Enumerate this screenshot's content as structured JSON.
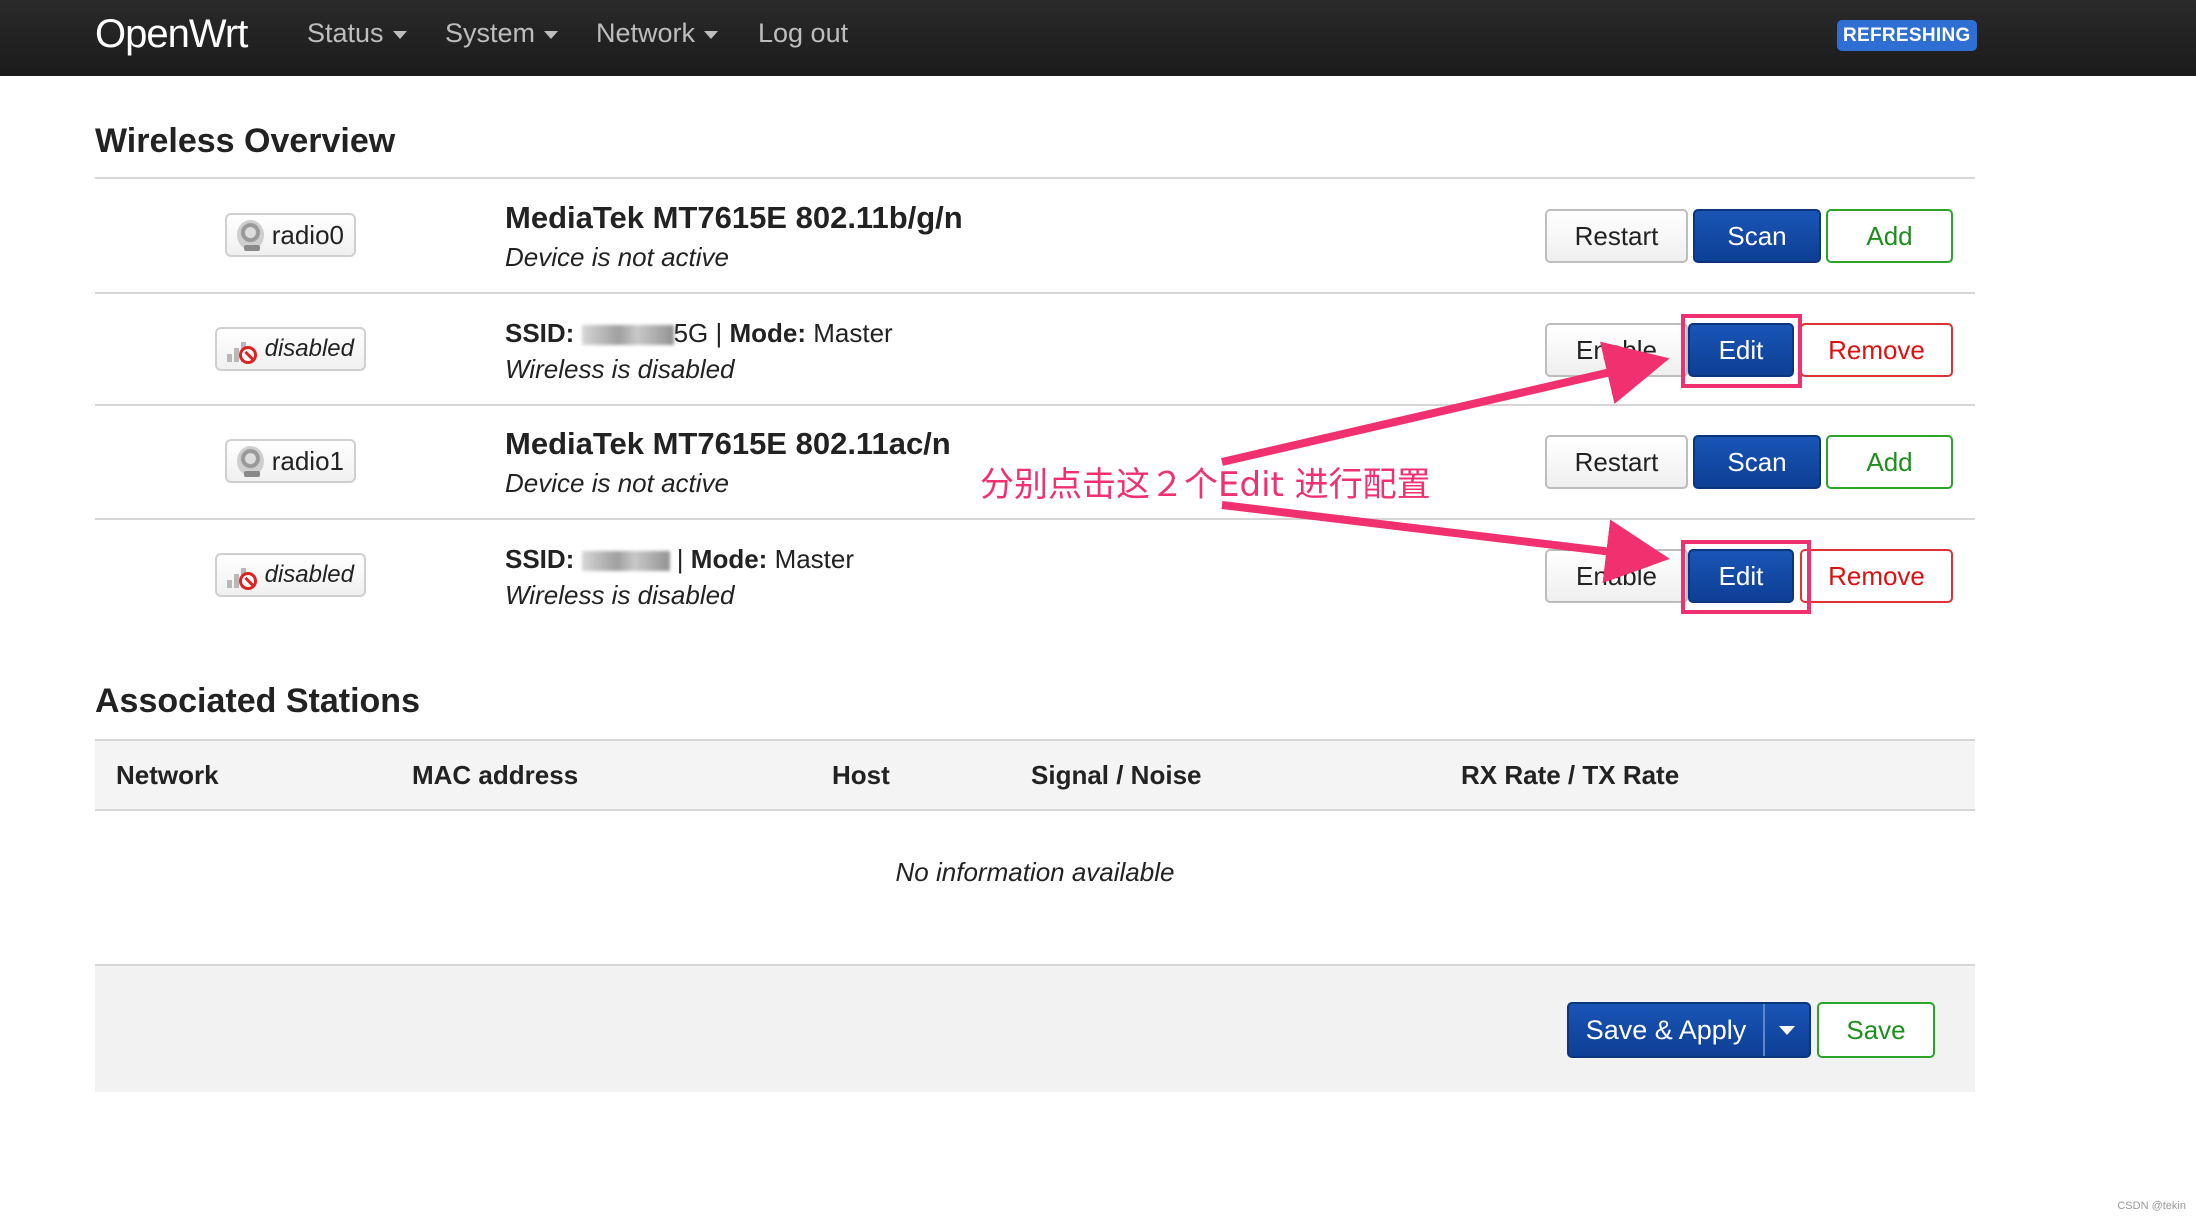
{
  "navbar": {
    "brand": "OpenWrt",
    "menu": [
      {
        "label": "Status",
        "has_dropdown": true
      },
      {
        "label": "System",
        "has_dropdown": true
      },
      {
        "label": "Network",
        "has_dropdown": true
      },
      {
        "label": "Log out",
        "has_dropdown": false
      }
    ],
    "refresh_badge": "REFRESHING"
  },
  "wireless_overview": {
    "title": "Wireless Overview",
    "devices": [
      {
        "badge": "radio0",
        "title": "MediaTek MT7615E 802.11b/g/n",
        "status": "Device is not active",
        "buttons": {
          "restart": "Restart",
          "scan": "Scan",
          "add": "Add"
        },
        "network": {
          "badge": "disabled",
          "ssid_label": "SSID:",
          "ssid_suffix": "5G",
          "mode_label": "Mode:",
          "mode_value": "Master",
          "status": "Wireless is disabled",
          "buttons": {
            "enable": "Enable",
            "edit": "Edit",
            "remove": "Remove"
          }
        }
      },
      {
        "badge": "radio1",
        "title": "MediaTek MT7615E 802.11ac/n",
        "status": "Device is not active",
        "buttons": {
          "restart": "Restart",
          "scan": "Scan",
          "add": "Add"
        },
        "network": {
          "badge": "disabled",
          "ssid_label": "SSID:",
          "ssid_suffix": "",
          "mode_label": "Mode:",
          "mode_value": "Master",
          "status": "Wireless is disabled",
          "buttons": {
            "enable": "Enable",
            "edit": "Edit",
            "remove": "Remove"
          }
        }
      }
    ]
  },
  "annotation": "分别点击这２个Edit 进行配置",
  "associated_stations": {
    "title": "Associated Stations",
    "columns": [
      "Network",
      "MAC address",
      "Host",
      "Signal / Noise",
      "RX Rate / TX Rate"
    ],
    "empty_message": "No information available"
  },
  "footer": {
    "save_apply": "Save & Apply",
    "save": "Save"
  },
  "watermark": "CSDN @tekin",
  "colors": {
    "primary": "#0d3f95",
    "positive": "#1e8f1e",
    "negative": "#d11111",
    "annotation": "#f0306f",
    "refresh_badge": "#2f6fd3"
  }
}
